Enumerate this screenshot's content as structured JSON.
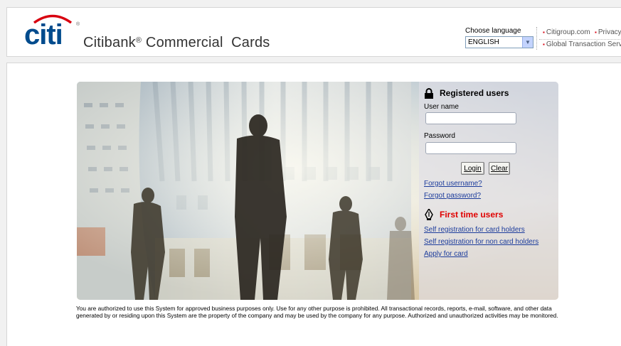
{
  "header": {
    "logo_text": "citi",
    "logo_reg": "®",
    "app_title": "Citibank",
    "app_title_reg": "®",
    "app_title_rest": " Commercial  Cards",
    "language_label": "Choose language",
    "language_value": "ENGLISH",
    "links": [
      "Citigroup.com",
      "Privacy",
      "Global Transaction Services"
    ],
    "bullet": "▪"
  },
  "login": {
    "heading": "Registered users",
    "username_label": "User name",
    "username_value": "",
    "password_label": "Password",
    "password_value": "",
    "login_button": "Login",
    "clear_button": "Clear",
    "forgot_username": "Forgot username?",
    "forgot_password": "Forgot password?"
  },
  "first_time": {
    "heading": "First time users",
    "links": [
      "Self registration for card holders",
      "Self registration for non card holders",
      "Apply for card"
    ]
  },
  "disclaimer": "You are authorized to use this System for approved business purposes only. Use for any other purpose is prohibited. All transactional records, reports, e-mail, software, and other data generated by or residing upon this System are the property of the company and may be used by the company for any purpose. Authorized and unauthorized activities may be monitored.",
  "colors": {
    "brand_blue": "#004b8d",
    "brand_red": "#d8000f",
    "link_blue": "#1c3c9c",
    "first_time_red": "#e00000"
  },
  "icons": {
    "lock": "lock-icon",
    "pen": "pen-icon",
    "dropdown": "chevron-down-icon"
  }
}
